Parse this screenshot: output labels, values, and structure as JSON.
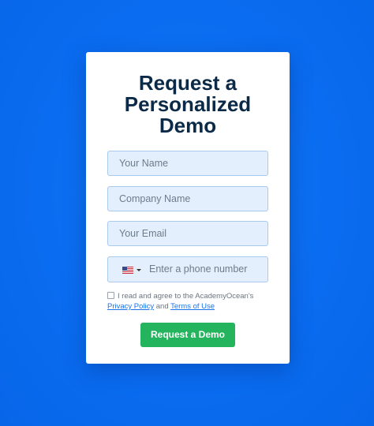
{
  "form": {
    "title_line1": "Request a",
    "title_line2": "Personalized",
    "title_line3": "Demo",
    "name_placeholder": "Your Name",
    "company_placeholder": "Company Name",
    "email_placeholder": "Your Email",
    "phone_placeholder": "Enter a phone number",
    "phone_country_icon": "us-flag-icon",
    "consent_text": "I read and agree to the AcademyOcean's",
    "privacy_link": "Privacy Policy",
    "and_text": "and",
    "terms_link": "Terms of Use",
    "submit_label": "Request a Demo",
    "colors": {
      "background": "#0a6cf0",
      "title": "#0b2a47",
      "field_bg": "#e3effd",
      "button": "#23b45d",
      "link": "#1a73e8"
    }
  }
}
